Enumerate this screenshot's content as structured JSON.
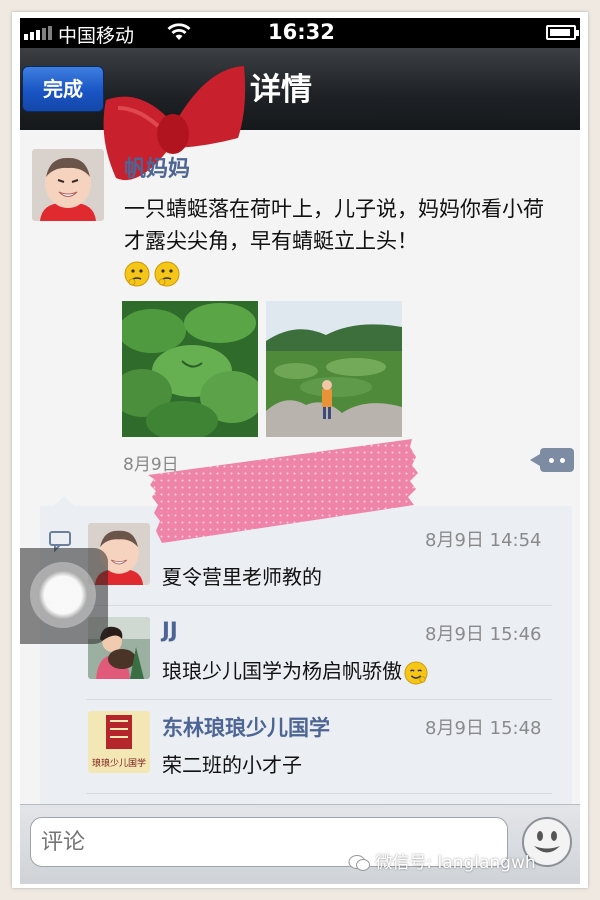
{
  "status_bar": {
    "carrier": "中国移动",
    "time": "16:32",
    "battery_level": 0.9
  },
  "nav": {
    "done_label": "完成",
    "title": "详情"
  },
  "post": {
    "author": "帆妈妈",
    "text": "一只蜻蜓落在荷叶上，儿子说，妈妈你看小荷才露尖尖角，早有蜻蜓立上头！",
    "emoji_count": 2,
    "time": "8月9日"
  },
  "comments": [
    {
      "name": "",
      "time": "8月9日 14:54",
      "text": "夏令营里老师教的"
    },
    {
      "name": "JJ",
      "time": "8月9日 15:46",
      "text": "琅琅少儿国学为杨启帆骄傲"
    },
    {
      "name": "东林琅琅少儿国学",
      "time": "8月9日 15:48",
      "text": "荣二班的小才子"
    }
  ],
  "comment_logo_text": "琅琅少儿国学",
  "input": {
    "placeholder": "评论"
  },
  "watermark": "微信号: langlangwh",
  "colors": {
    "nav_bg": "#1f2226",
    "done_button": "#1a55c4",
    "author_link": "#4c6594",
    "tape_pink": "#f07aa3",
    "bow_red": "#c8202c"
  },
  "icons": [
    "wifi-icon",
    "battery-icon",
    "comment-bubble-icon",
    "more-options-icon",
    "smiley-icon",
    "wechat-icon"
  ]
}
